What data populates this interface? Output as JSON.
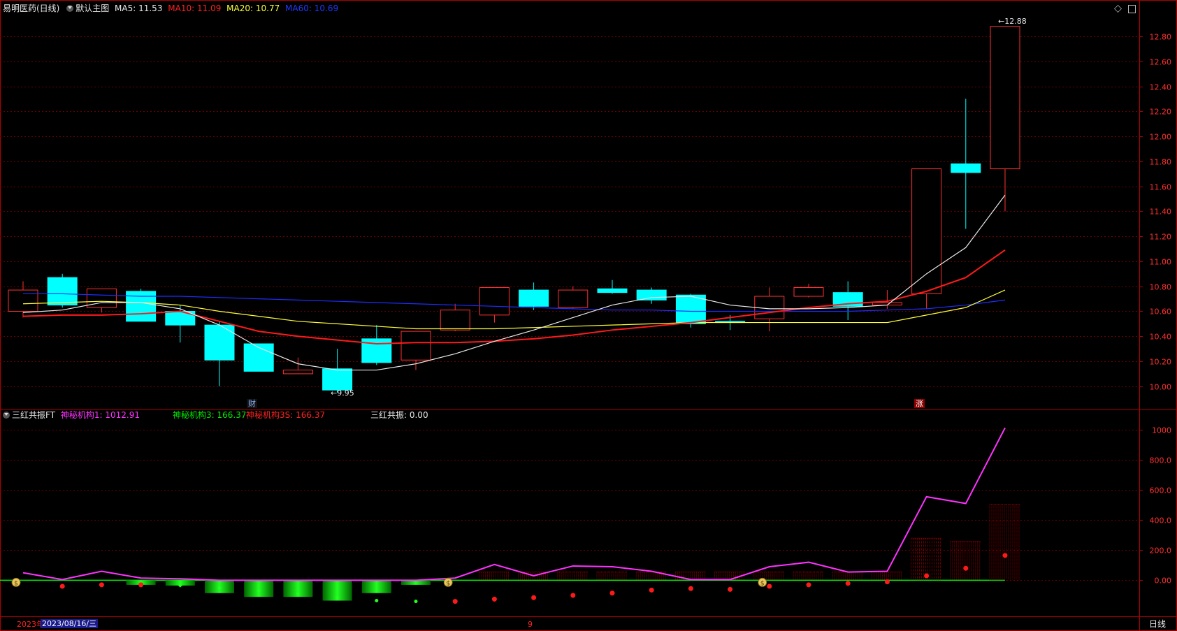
{
  "main_header": {
    "stock_title": "易明医药(日线)",
    "indicator_name": "默认主图",
    "ma5": "MA5: 11.53",
    "ma10": "MA10: 11.09",
    "ma20": "MA20: 10.77",
    "ma60": "MA60: 10.69"
  },
  "sub_header": {
    "indicator_name": "三红共振FT",
    "line1": "神秘机构1: 1012.91",
    "line3": "神秘机构3: 166.37",
    "line3s": "神秘机构3S: 166.37",
    "resonance": "三红共振: 0.00"
  },
  "main_chart": {
    "y_ticks": [
      "12.80",
      "12.60",
      "12.40",
      "12.20",
      "12.00",
      "11.80",
      "11.60",
      "11.40",
      "11.20",
      "11.00",
      "10.80",
      "10.60",
      "10.40",
      "10.20",
      "10.00"
    ],
    "y_range": [
      9.82,
      12.99
    ],
    "high_label": "12.88",
    "low_label": "9.95",
    "marker_cai": "财",
    "marker_zhang": "涨",
    "candles": [
      {
        "o": 10.6,
        "h": 10.84,
        "l": 10.55,
        "c": 10.77
      },
      {
        "o": 10.87,
        "h": 10.9,
        "l": 10.63,
        "c": 10.65
      },
      {
        "o": 10.63,
        "h": 10.78,
        "l": 10.59,
        "c": 10.78
      },
      {
        "o": 10.76,
        "h": 10.78,
        "l": 10.52,
        "c": 10.52
      },
      {
        "o": 10.6,
        "h": 10.65,
        "l": 10.35,
        "c": 10.49
      },
      {
        "o": 10.49,
        "h": 10.52,
        "l": 10.0,
        "c": 10.21
      },
      {
        "o": 10.34,
        "h": 10.34,
        "l": 10.12,
        "c": 10.12
      },
      {
        "o": 10.1,
        "h": 10.23,
        "l": 10.1,
        "c": 10.13
      },
      {
        "o": 10.14,
        "h": 10.3,
        "l": 9.95,
        "c": 9.97
      },
      {
        "o": 10.38,
        "h": 10.49,
        "l": 10.17,
        "c": 10.19
      },
      {
        "o": 10.21,
        "h": 10.44,
        "l": 10.13,
        "c": 10.44
      },
      {
        "o": 10.45,
        "h": 10.66,
        "l": 10.44,
        "c": 10.61
      },
      {
        "o": 10.57,
        "h": 10.79,
        "l": 10.51,
        "c": 10.79
      },
      {
        "o": 10.77,
        "h": 10.83,
        "l": 10.61,
        "c": 10.64
      },
      {
        "o": 10.63,
        "h": 10.8,
        "l": 10.62,
        "c": 10.77
      },
      {
        "o": 10.78,
        "h": 10.85,
        "l": 10.74,
        "c": 10.75
      },
      {
        "o": 10.77,
        "h": 10.79,
        "l": 10.66,
        "c": 10.69
      },
      {
        "o": 10.73,
        "h": 10.74,
        "l": 10.47,
        "c": 10.5
      },
      {
        "o": 10.52,
        "h": 10.57,
        "l": 10.45,
        "c": 10.51
      },
      {
        "o": 10.54,
        "h": 10.79,
        "l": 10.44,
        "c": 10.72
      },
      {
        "o": 10.72,
        "h": 10.82,
        "l": 10.71,
        "c": 10.79
      },
      {
        "o": 10.75,
        "h": 10.84,
        "l": 10.53,
        "c": 10.64
      },
      {
        "o": 10.65,
        "h": 10.77,
        "l": 10.62,
        "c": 10.67
      },
      {
        "o": 10.74,
        "h": 10.75,
        "l": 10.62,
        "c": 11.74
      },
      {
        "o": 11.78,
        "h": 12.3,
        "l": 11.26,
        "c": 11.71
      },
      {
        "o": 11.74,
        "h": 12.88,
        "l": 11.4,
        "c": 12.88
      }
    ],
    "ma5": [
      10.59,
      10.61,
      10.67,
      10.67,
      10.62,
      10.49,
      10.31,
      10.18,
      10.13,
      10.13,
      10.18,
      10.26,
      10.36,
      10.45,
      10.55,
      10.65,
      10.71,
      10.72,
      10.65,
      10.62,
      10.62,
      10.63,
      10.65,
      10.9,
      11.11,
      11.53
    ],
    "ma10": [
      10.56,
      10.56,
      10.57,
      10.57,
      10.58,
      10.6,
      10.52,
      10.44,
      10.4,
      10.37,
      10.34,
      10.35,
      10.35,
      10.36,
      10.38,
      10.41,
      10.45,
      10.48,
      10.51,
      10.55,
      10.59,
      10.63,
      10.66,
      10.68,
      10.76,
      10.87,
      11.09
    ],
    "ma20": [
      10.66,
      10.67,
      10.68,
      10.67,
      10.65,
      10.6,
      10.56,
      10.52,
      10.5,
      10.48,
      10.46,
      10.46,
      10.46,
      10.47,
      10.48,
      10.49,
      10.5,
      10.51,
      10.51,
      10.51,
      10.51,
      10.51,
      10.51,
      10.57,
      10.63,
      10.77
    ],
    "ma60": [
      10.74,
      10.74,
      10.73,
      10.72,
      10.72,
      10.71,
      10.7,
      10.69,
      10.68,
      10.67,
      10.66,
      10.65,
      10.64,
      10.63,
      10.62,
      10.61,
      10.61,
      10.6,
      10.6,
      10.6,
      10.6,
      10.6,
      10.61,
      10.62,
      10.65,
      10.69
    ]
  },
  "sub_chart": {
    "y_ticks": [
      "1000",
      "800.0",
      "600.0",
      "400.0",
      "200.0",
      "0.00"
    ],
    "y_range": [
      -230,
      1060
    ],
    "line1": [
      50,
      5,
      60,
      15,
      10,
      0,
      0,
      0,
      0,
      0,
      0,
      15,
      105,
      30,
      95,
      90,
      60,
      5,
      5,
      90,
      120,
      55,
      60,
      555,
      510,
      1012
    ],
    "green_bars": [
      0,
      0,
      0,
      -30,
      -35,
      -85,
      -110,
      -110,
      -135,
      -85,
      -30,
      0,
      0,
      0,
      0,
      0,
      0,
      0,
      0,
      0,
      0,
      0,
      0,
      0,
      0,
      0
    ],
    "red_bars": [
      0,
      0,
      0,
      0,
      0,
      0,
      0,
      0,
      0,
      0,
      0,
      0,
      55,
      55,
      55,
      55,
      55,
      55,
      55,
      55,
      55,
      55,
      55,
      280,
      260,
      505
    ],
    "dots": [
      {
        "i": 1,
        "v": -40,
        "c": "red"
      },
      {
        "i": 2,
        "v": -30,
        "c": "red"
      },
      {
        "i": 3,
        "v": -30,
        "c": "red"
      },
      {
        "i": 4,
        "v": -35,
        "c": "green"
      },
      {
        "i": 5,
        "v": -50,
        "c": "green"
      },
      {
        "i": 6,
        "v": -70,
        "c": "green"
      },
      {
        "i": 7,
        "v": -90,
        "c": "green"
      },
      {
        "i": 8,
        "v": -115,
        "c": "green"
      },
      {
        "i": 9,
        "v": -135,
        "c": "green"
      },
      {
        "i": 10,
        "v": -140,
        "c": "green"
      },
      {
        "i": 11,
        "v": -140,
        "c": "red"
      },
      {
        "i": 12,
        "v": -125,
        "c": "red"
      },
      {
        "i": 13,
        "v": -115,
        "c": "red"
      },
      {
        "i": 14,
        "v": -100,
        "c": "red"
      },
      {
        "i": 15,
        "v": -85,
        "c": "red"
      },
      {
        "i": 16,
        "v": -65,
        "c": "red"
      },
      {
        "i": 17,
        "v": -55,
        "c": "red"
      },
      {
        "i": 18,
        "v": -60,
        "c": "red"
      },
      {
        "i": 19,
        "v": -40,
        "c": "red"
      },
      {
        "i": 20,
        "v": -30,
        "c": "red"
      },
      {
        "i": 21,
        "v": -20,
        "c": "red"
      },
      {
        "i": 22,
        "v": -10,
        "c": "red"
      },
      {
        "i": 23,
        "v": 30,
        "c": "red"
      },
      {
        "i": 24,
        "v": 80,
        "c": "red"
      },
      {
        "i": 25,
        "v": 165,
        "c": "red"
      }
    ],
    "money_at": [
      0,
      11,
      19
    ],
    "money_glyph": "$"
  },
  "bottom_bar": {
    "year_text": "2023年",
    "date_text": "2023/08/16/三",
    "month_mark": "9",
    "period_label": "日线"
  },
  "colors": {
    "bg": "#000000",
    "grid": "#6a0000",
    "axis": "#b00000",
    "up": "#ff3030",
    "down": "#00ffff",
    "ma5": "#e8e8e8",
    "ma10": "#ff1a1a",
    "ma20": "#ffff33",
    "ma60": "#1e2dff",
    "line1": "#ff33ff",
    "green": "#00ee00"
  }
}
